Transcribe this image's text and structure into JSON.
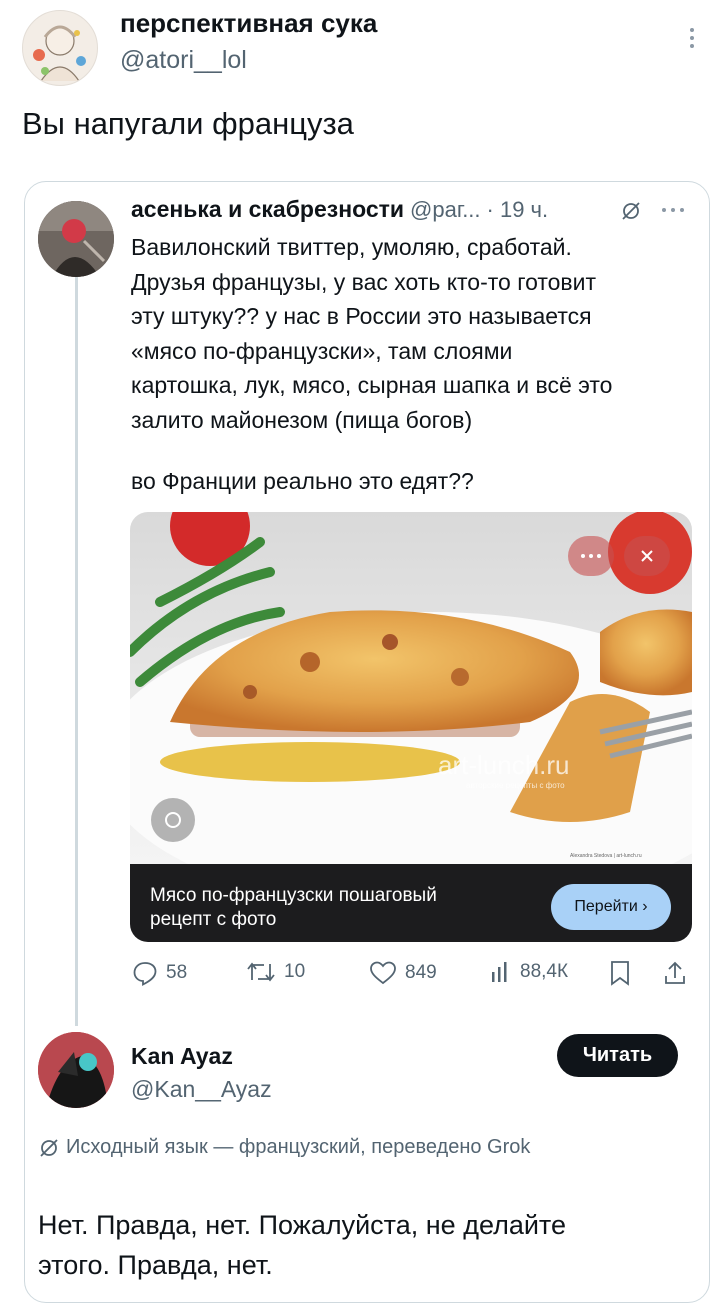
{
  "quote_author": {
    "name": "перспективная сука",
    "handle": "@atori__lol",
    "more_icon": "vertical-dots-icon"
  },
  "quote_text": "Вы напугали француза",
  "original_tweet": {
    "name": "асенька и скабрезности",
    "handle": "@раг...",
    "time": "· 19 ч.",
    "grok_icon": "grok-icon",
    "more_icon": "more-dots-icon",
    "lines": [
      "Вавилонский твиттер, умоляю, сработай.",
      "Друзья французы, у вас хоть кто-то готовит",
      "эту штуку?? у нас в России это называется",
      "«мясо по-французски», там слоями",
      "картошка, лук, мясо, сырная шапка и всё это",
      "залито майонезом (пища богов)"
    ],
    "question": "во Франции реально это едят??",
    "image": {
      "watermark": "art-lunch.ru",
      "watermark_sub": "авторские рецепты с фото",
      "credit": "Alexandra Stedova | art-lunch.ru",
      "caption": "Мясо по-французски пошаговый рецепт с фото",
      "caption_line1": "Мясо по-французски пошаговый",
      "caption_line2": "рецепт с фото",
      "go_button": "Перейти ›"
    },
    "actions": {
      "replies": "58",
      "reposts": "10",
      "likes": "849",
      "views": "88,4К"
    }
  },
  "reply": {
    "name": "Kan Ayaz",
    "handle": "@Kan__Ayaz",
    "follow_button": "Читать",
    "translation_note": "Исходный язык — французский, переведено Grok",
    "text_line1": "Нет. Правда, нет. Пожалуйста, не делайте",
    "text_line2": "этого. Правда, нет."
  },
  "colors": {
    "text": "#0f1419",
    "muted": "#536471",
    "border": "#cfd9de",
    "go_button_bg": "#a9d1f7",
    "follow_bg": "#0f1419"
  }
}
